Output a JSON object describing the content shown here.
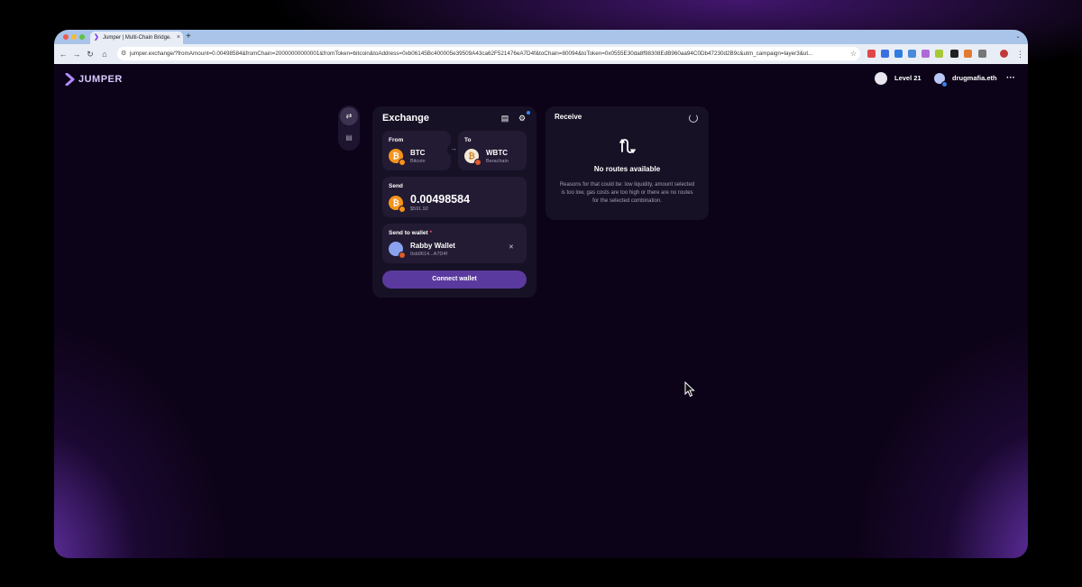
{
  "browser": {
    "tab_title": "Jumper | Multi-Chain Bridge...",
    "address_bar": "jumper.exchange/?fromAmount=0.00498584&fromChain=20000000000001&fromToken=bitcoin&toAddress=0xb06145Bc400005e39509A43ca62F521476eA7D4f&toChain=80094&toToken=0x0555E30da8f98308EdB960aa94C0Db47230d2B9c&utm_campaign=layer3&ut..."
  },
  "header": {
    "logo_text": "JUMPER",
    "level": "Level 21",
    "wallet_name": "drugmafia.eth"
  },
  "exchange": {
    "title": "Exchange",
    "from": {
      "label": "From",
      "symbol": "BTC",
      "chain": "Bitcoin",
      "coin_glyph": "₿"
    },
    "to": {
      "label": "To",
      "symbol": "WBTC",
      "chain": "Berachain",
      "coin_glyph": "₿"
    },
    "send": {
      "label": "Send",
      "amount": "0.00498584",
      "usd": "$591.92"
    },
    "send_to_wallet": {
      "label": "Send to wallet",
      "required_mark": "*",
      "wallet": "Rabby Wallet",
      "address": "0xb0614...A7D4f"
    },
    "connect_label": "Connect wallet"
  },
  "receive": {
    "title": "Receive",
    "empty_title": "No routes available",
    "empty_text": "Reasons for that could be: low liquidity, amount selected is too low, gas costs are too high or there are no routes for the selected combination."
  },
  "colors": {
    "accent": "#5a3a9e",
    "card": "#171126",
    "tile": "#221b33",
    "background": "#0d0318"
  },
  "icons": [
    "back-icon",
    "forward-icon",
    "reload-icon",
    "home-icon",
    "site-info-icon",
    "bookmark-star-icon",
    "settings-gear-icon",
    "history-icon",
    "swap-icon",
    "route-icon",
    "spinner-icon",
    "close-icon",
    "more-icon"
  ]
}
